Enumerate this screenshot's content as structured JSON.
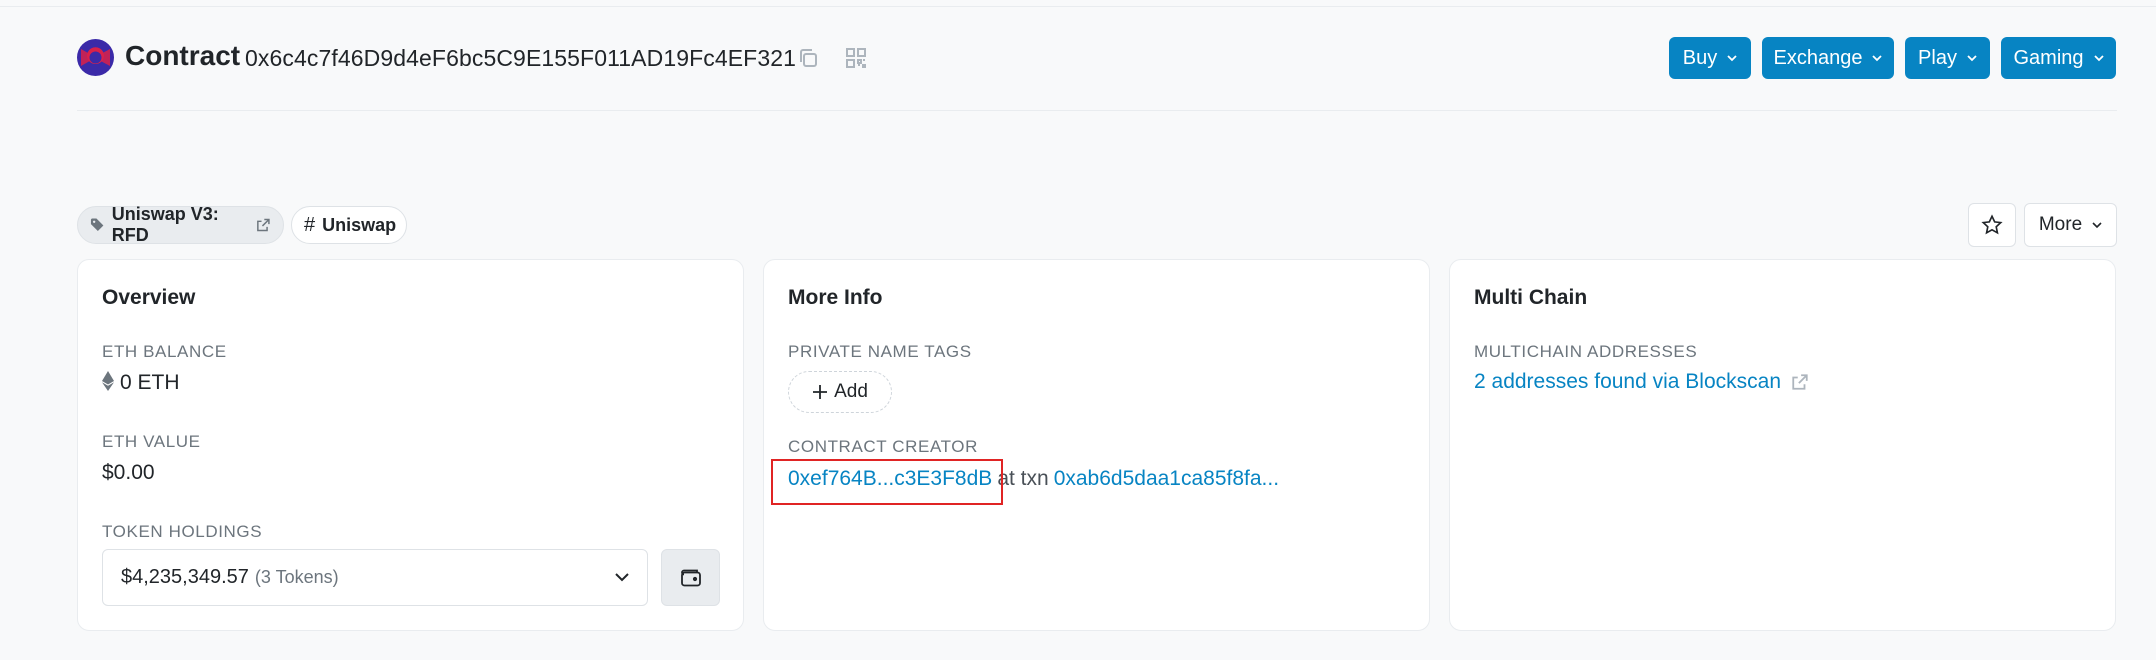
{
  "header": {
    "title": "Contract",
    "address": "0x6c4c7f46D9d4eF6bc5C9E155F011AD19Fc4EF321",
    "buttons": [
      {
        "label": "Buy"
      },
      {
        "label": "Exchange"
      },
      {
        "label": "Play"
      },
      {
        "label": "Gaming"
      }
    ]
  },
  "tags": {
    "tag1": "Uniswap V3: RFD",
    "tag2": "Uniswap"
  },
  "toolbar": {
    "more_label": "More"
  },
  "overview": {
    "title": "Overview",
    "eth_balance_label": "ETH BALANCE",
    "eth_balance": "0 ETH",
    "eth_value_label": "ETH VALUE",
    "eth_value": "$0.00",
    "token_holdings_label": "TOKEN HOLDINGS",
    "token_amount": "$4,235,349.57",
    "token_count": "(3 Tokens)"
  },
  "more_info": {
    "title": "More Info",
    "private_tags_label": "PRIVATE NAME TAGS",
    "add_label": "Add",
    "creator_label": "CONTRACT CREATOR",
    "creator_address": "0xef764B...c3E3F8dB",
    "at_txn": "at txn",
    "txn_hash": "0xab6d5daa1ca85f8fa..."
  },
  "multi_chain": {
    "title": "Multi Chain",
    "addresses_label": "MULTICHAIN ADDRESSES",
    "addresses_link": "2 addresses found via Blockscan"
  },
  "colors": {
    "accent": "#0784c3",
    "highlight": "#e02424"
  }
}
